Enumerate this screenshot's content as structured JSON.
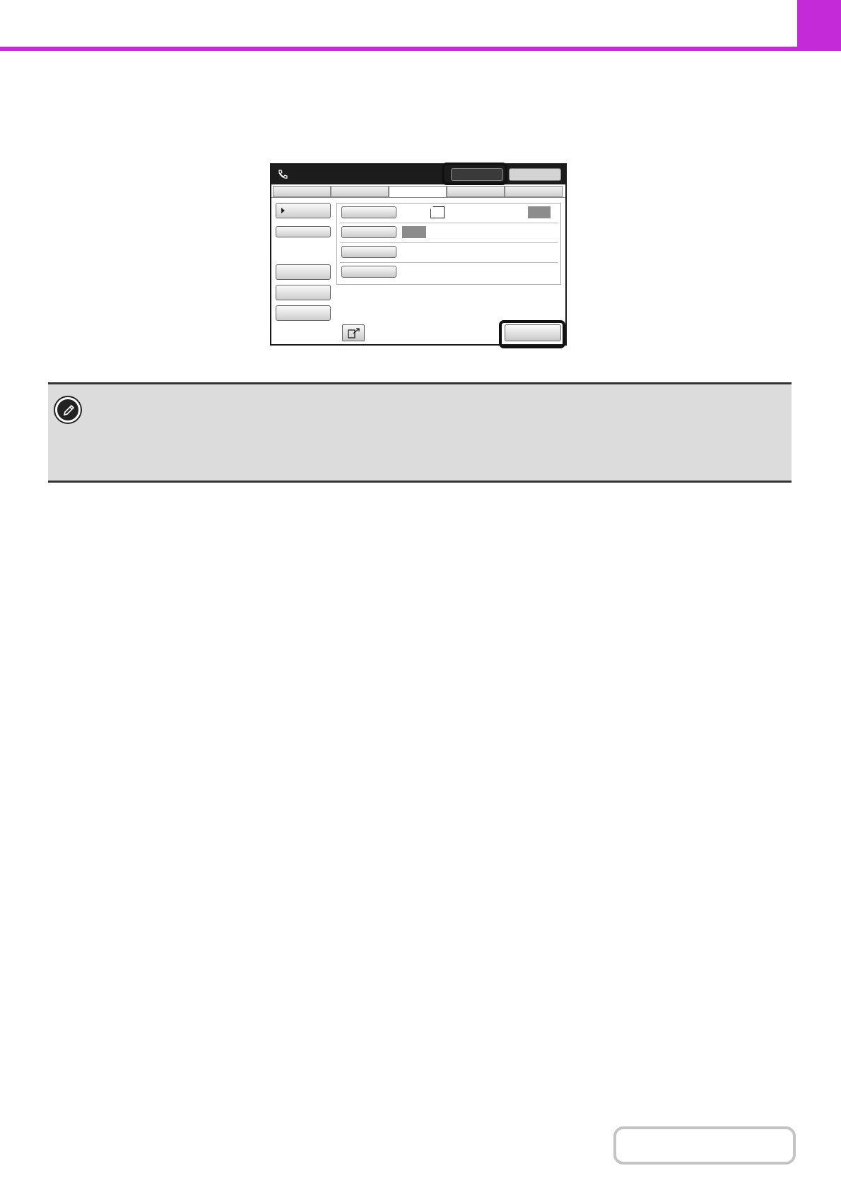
{
  "theme": {
    "accent": "#c52ad8",
    "note_background": "#dcdcdc"
  },
  "header": {
    "corner_tab_color": "#c52ad8"
  },
  "fax_screen": {
    "header_icon": "phone-icon",
    "preview_icon": "preview-icon"
  },
  "note": {
    "icon": "pencil-note-icon"
  }
}
